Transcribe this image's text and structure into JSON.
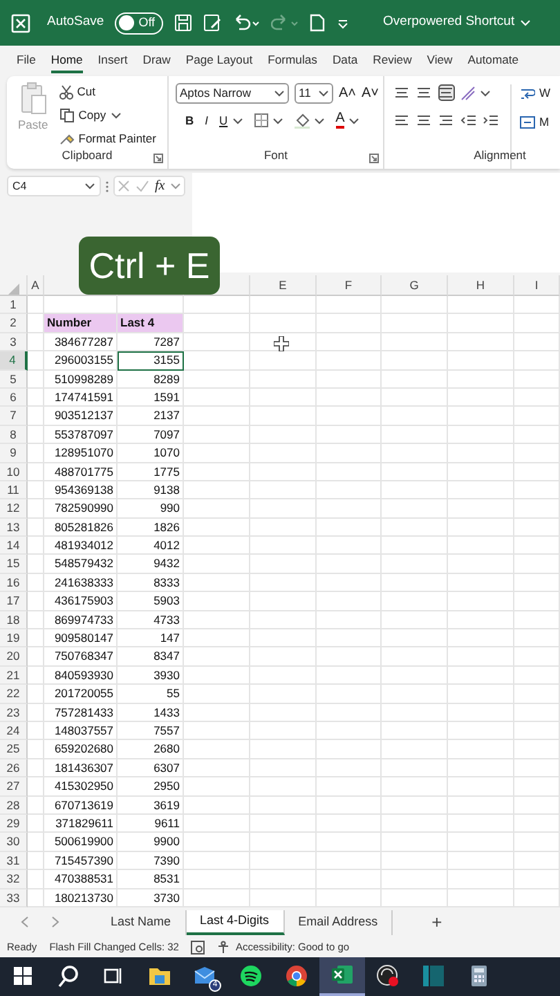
{
  "title_bar": {
    "autosave_label": "AutoSave",
    "autosave": {
      "on": false,
      "label": "Off"
    },
    "title": "Overpowered Shortcut"
  },
  "menu_tabs": [
    {
      "label": "File",
      "selected": false
    },
    {
      "label": "Home",
      "selected": true
    },
    {
      "label": "Insert",
      "selected": false
    },
    {
      "label": "Draw",
      "selected": false
    },
    {
      "label": "Page Layout",
      "selected": false
    },
    {
      "label": "Formulas",
      "selected": false
    },
    {
      "label": "Data",
      "selected": false
    },
    {
      "label": "Review",
      "selected": false
    },
    {
      "label": "View",
      "selected": false
    },
    {
      "label": "Automate",
      "selected": false
    }
  ],
  "ribbon": {
    "clipboard": {
      "paste": {
        "label": "Paste",
        "disabled": true
      },
      "cut": "Cut",
      "copy": "Copy",
      "format_painter": "Format Painter",
      "label": "Clipboard"
    },
    "font": {
      "name": "Aptos Narrow",
      "size": "11",
      "size_buttons": [
        "A˄",
        "A˅"
      ],
      "bold": "B",
      "italic": "I",
      "underline": "U",
      "font_color": "A",
      "label": "Font"
    },
    "alignment": {
      "wrap": "W",
      "merge": "M",
      "label": "Alignment"
    }
  },
  "formula_bar": {
    "name_box": "C4",
    "fx": "fx"
  },
  "shortcut_badge": "Ctrl + E",
  "column_headers": [
    "A",
    "E",
    "F",
    "G",
    "H",
    "I"
  ],
  "rows": [
    {
      "n": "1",
      "kind": "blank",
      "selected": false
    },
    {
      "n": "2",
      "kind": "header",
      "b": "Number",
      "c": "Last 4",
      "selected": false
    },
    {
      "n": "3",
      "kind": "data",
      "b": "384677287",
      "c": "7287",
      "selected": false
    },
    {
      "n": "4",
      "kind": "data",
      "b": "296003155",
      "c": "3155",
      "selected": true
    },
    {
      "n": "5",
      "kind": "data",
      "b": "510998289",
      "c": "8289",
      "selected": false
    },
    {
      "n": "6",
      "kind": "data",
      "b": "174741591",
      "c": "1591",
      "selected": false
    },
    {
      "n": "7",
      "kind": "data",
      "b": "903512137",
      "c": "2137",
      "selected": false
    },
    {
      "n": "8",
      "kind": "data",
      "b": "553787097",
      "c": "7097",
      "selected": false
    },
    {
      "n": "9",
      "kind": "data",
      "b": "128951070",
      "c": "1070",
      "selected": false
    },
    {
      "n": "10",
      "kind": "data",
      "b": "488701775",
      "c": "1775",
      "selected": false
    },
    {
      "n": "11",
      "kind": "data",
      "b": "954369138",
      "c": "9138",
      "selected": false
    },
    {
      "n": "12",
      "kind": "data",
      "b": "782590990",
      "c": "990",
      "selected": false
    },
    {
      "n": "13",
      "kind": "data",
      "b": "805281826",
      "c": "1826",
      "selected": false
    },
    {
      "n": "14",
      "kind": "data",
      "b": "481934012",
      "c": "4012",
      "selected": false
    },
    {
      "n": "15",
      "kind": "data",
      "b": "548579432",
      "c": "9432",
      "selected": false
    },
    {
      "n": "16",
      "kind": "data",
      "b": "241638333",
      "c": "8333",
      "selected": false
    },
    {
      "n": "17",
      "kind": "data",
      "b": "436175903",
      "c": "5903",
      "selected": false
    },
    {
      "n": "18",
      "kind": "data",
      "b": "869974733",
      "c": "4733",
      "selected": false
    },
    {
      "n": "19",
      "kind": "data",
      "b": "909580147",
      "c": "147",
      "selected": false
    },
    {
      "n": "20",
      "kind": "data",
      "b": "750768347",
      "c": "8347",
      "selected": false
    },
    {
      "n": "21",
      "kind": "data",
      "b": "840593930",
      "c": "3930",
      "selected": false
    },
    {
      "n": "22",
      "kind": "data",
      "b": "201720055",
      "c": "55",
      "selected": false
    },
    {
      "n": "23",
      "kind": "data",
      "b": "757281433",
      "c": "1433",
      "selected": false
    },
    {
      "n": "24",
      "kind": "data",
      "b": "148037557",
      "c": "7557",
      "selected": false
    },
    {
      "n": "25",
      "kind": "data",
      "b": "659202680",
      "c": "2680",
      "selected": false
    },
    {
      "n": "26",
      "kind": "data",
      "b": "181436307",
      "c": "6307",
      "selected": false
    },
    {
      "n": "27",
      "kind": "data",
      "b": "415302950",
      "c": "2950",
      "selected": false
    },
    {
      "n": "28",
      "kind": "data",
      "b": "670713619",
      "c": "3619",
      "selected": false
    },
    {
      "n": "29",
      "kind": "data",
      "b": "371829611",
      "c": "9611",
      "selected": false
    },
    {
      "n": "30",
      "kind": "data",
      "b": "500619900",
      "c": "9900",
      "selected": false
    },
    {
      "n": "31",
      "kind": "data",
      "b": "715457390",
      "c": "7390",
      "selected": false
    },
    {
      "n": "32",
      "kind": "data",
      "b": "470388531",
      "c": "8531",
      "selected": false
    },
    {
      "n": "33",
      "kind": "data",
      "b": "180213730",
      "c": "3730",
      "selected": false
    }
  ],
  "sheet_tabs": [
    {
      "label": "Last Name",
      "selected": false
    },
    {
      "label": "Last 4-Digits",
      "selected": true
    },
    {
      "label": "Email Address",
      "selected": false
    }
  ],
  "new_sheet": "+",
  "status_bar": {
    "ready": "Ready",
    "flash_fill": "Flash Fill Changed Cells: 32",
    "accessibility": "Accessibility: Good to go"
  },
  "taskbar": [
    {
      "kind": "start",
      "selected": false
    },
    {
      "kind": "search",
      "selected": false
    },
    {
      "kind": "taskview",
      "selected": false
    },
    {
      "kind": "folder",
      "selected": false
    },
    {
      "kind": "mail",
      "badge": "4",
      "selected": false
    },
    {
      "kind": "spotify",
      "selected": false
    },
    {
      "kind": "chrome",
      "selected": false
    },
    {
      "kind": "excel",
      "selected": true
    },
    {
      "kind": "recorder",
      "selected": false
    },
    {
      "kind": "panel",
      "selected": false
    },
    {
      "kind": "calculator",
      "selected": false
    }
  ]
}
